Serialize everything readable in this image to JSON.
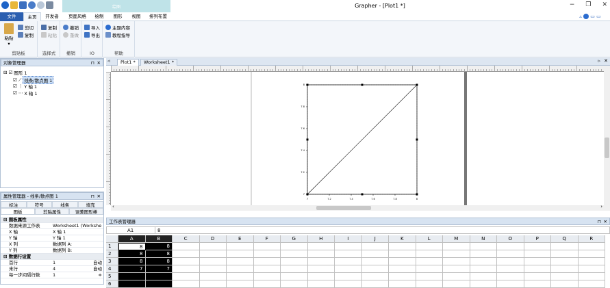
{
  "app": {
    "title": "Grapher - [Plot1 *]",
    "context_tab_group": "绘图",
    "window_controls": {
      "minimize": "−",
      "restore": "❐",
      "close": "✕"
    }
  },
  "ribbon_tabs": [
    {
      "label": "文件"
    },
    {
      "label": "主页"
    },
    {
      "label": "开发者"
    },
    {
      "label": "页面风格"
    },
    {
      "label": "绘制"
    },
    {
      "label": "图形"
    },
    {
      "label": "视图"
    },
    {
      "label": "排列布置"
    }
  ],
  "ribbon": {
    "clipboard": {
      "paste": "粘贴",
      "cut": "剪切",
      "copy": "复制",
      "group_label": "剪贴板"
    },
    "selection": {
      "copy": "复制",
      "paste": "粘贴",
      "group_label": "选择式"
    },
    "undo": {
      "undo": "撤销",
      "redo": "重做",
      "group_label": "撤销"
    },
    "io": {
      "import": "导入",
      "export": "导出",
      "group_label": "IO"
    },
    "help": {
      "topics": "主题内容",
      "tutorial": "教程指导",
      "group_label": "帮助"
    }
  },
  "object_manager": {
    "title": "对象管理器",
    "pin": "⊓",
    "close": "✕",
    "tree": [
      {
        "label": "图形 1",
        "level": 0
      },
      {
        "label": "线条/散点图 1",
        "level": 1,
        "selected": true
      },
      {
        "label": "Y 轴 1",
        "level": 1
      },
      {
        "label": "X 轴 1",
        "level": 1
      }
    ]
  },
  "property_manager": {
    "title": "属性管理器 - 线条/散点图 1",
    "tabs_row1": [
      "标注",
      "符号",
      "线条",
      "填充"
    ],
    "tabs_row2": [
      "图板",
      "剪贴属性",
      "误差图形棒"
    ],
    "rows": [
      {
        "label": "图板属性",
        "value": "",
        "header": true
      },
      {
        "label": "数据来源工作表",
        "value": "Worksheet1 (Workshe"
      },
      {
        "label": "X 轴",
        "value": "X 轴 1"
      },
      {
        "label": "Y 轴",
        "value": "Y 轴 1"
      },
      {
        "label": "X 列",
        "value": "数据列 A:"
      },
      {
        "label": "Y 列",
        "value": "数据列 B:"
      },
      {
        "label": "数据行设置",
        "value": "",
        "header": true
      },
      {
        "label": "首行",
        "value": "1",
        "extra": "自动"
      },
      {
        "label": "末行",
        "value": "4",
        "extra": "自动"
      },
      {
        "label": "每一步间隔行数",
        "value": "1",
        "extra": "≑"
      }
    ]
  },
  "doc_tabs": [
    "Plot1 *",
    "Worksheet1 *"
  ],
  "plot": {
    "chart_data": {
      "type": "line",
      "x": [
        7,
        8
      ],
      "y": [
        7,
        8
      ],
      "xlim": [
        7,
        8
      ],
      "ylim": [
        7,
        8
      ],
      "x_ticks": [
        "7",
        "7.2",
        "7.4",
        "7.6",
        "7.8",
        "8"
      ],
      "y_ticks": [
        "7",
        "7.2",
        "7.4",
        "7.6",
        "7.8",
        "8"
      ]
    }
  },
  "worksheet_manager": {
    "title": "工作表管理器",
    "cell_ref": "A1",
    "cell_value": "8",
    "columns": [
      "A",
      "B",
      "C",
      "D",
      "E",
      "F",
      "G",
      "H",
      "I",
      "J",
      "K",
      "L",
      "M",
      "N",
      "O",
      "P",
      "Q",
      "R"
    ],
    "rows": [
      {
        "n": "1",
        "A": "8",
        "B": "8"
      },
      {
        "n": "2",
        "A": "8",
        "B": "8"
      },
      {
        "n": "3",
        "A": "8",
        "B": "8"
      },
      {
        "n": "4",
        "A": "7",
        "B": "7"
      },
      {
        "n": "5",
        "A": "",
        "B": ""
      },
      {
        "n": "6",
        "A": "",
        "B": ""
      }
    ]
  }
}
